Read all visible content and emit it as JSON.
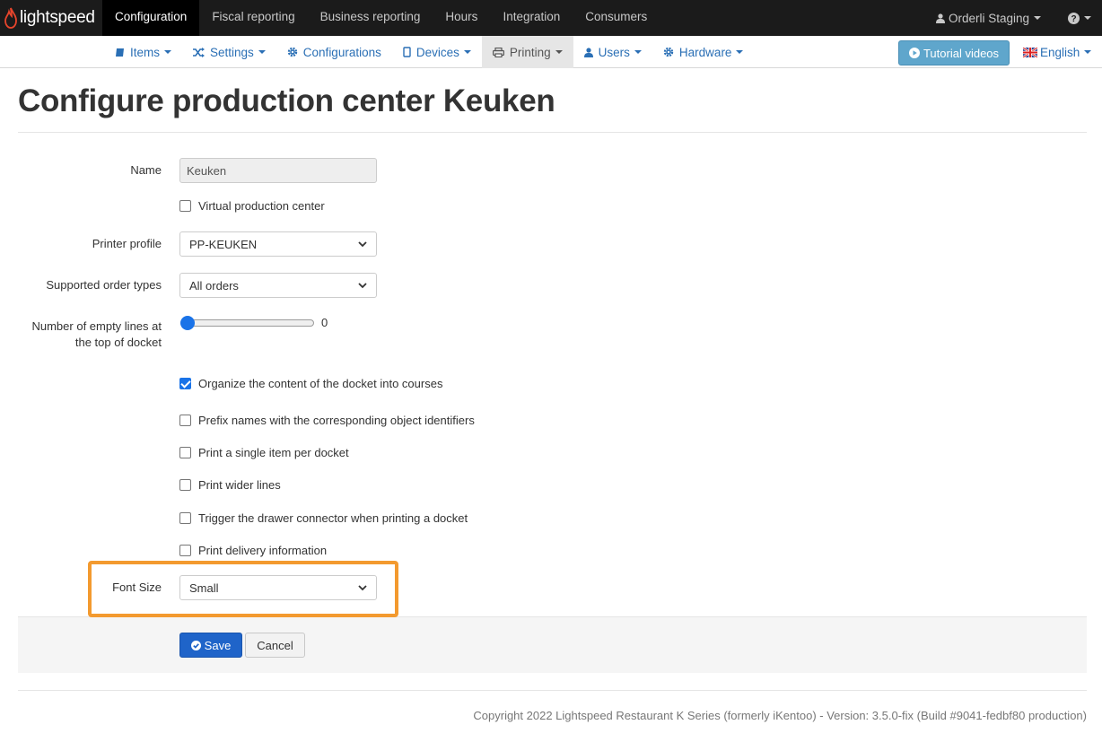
{
  "brand": {
    "name": "lightspeed"
  },
  "topnav": [
    {
      "label": "Configuration",
      "active": true
    },
    {
      "label": "Fiscal reporting"
    },
    {
      "label": "Business reporting"
    },
    {
      "label": "Hours"
    },
    {
      "label": "Integration"
    },
    {
      "label": "Consumers"
    }
  ],
  "account": {
    "label": "Orderli Staging"
  },
  "subnav": [
    {
      "label": "Items",
      "icon": "book-icon"
    },
    {
      "label": "Settings",
      "icon": "shuffle-icon"
    },
    {
      "label": "Configurations",
      "icon": "gear-icon"
    },
    {
      "label": "Devices",
      "icon": "tablet-icon"
    },
    {
      "label": "Printing",
      "icon": "printer-icon",
      "active": true
    },
    {
      "label": "Users",
      "icon": "user-icon"
    },
    {
      "label": "Hardware",
      "icon": "gear-icon"
    }
  ],
  "tutorial_button": "Tutorial videos",
  "language": "English",
  "page_title": "Configure production center Keuken",
  "form": {
    "name_label": "Name",
    "name_value": "Keuken",
    "virtual_label": "Virtual production center",
    "printer_profile_label": "Printer profile",
    "printer_profile_value": "PP-KEUKEN",
    "order_types_label": "Supported order types",
    "order_types_value": "All orders",
    "empty_lines_label_1": "Number of empty lines at",
    "empty_lines_label_2": "the top of docket",
    "empty_lines_value": "0",
    "empty_lines_level": 0,
    "options": [
      {
        "label": "Organize the content of the docket into courses",
        "checked": true
      },
      {
        "label": "Prefix names with the corresponding object identifiers",
        "checked": false
      },
      {
        "label": "Print a single item per docket",
        "checked": false
      },
      {
        "label": "Print wider lines",
        "checked": false
      },
      {
        "label": "Trigger the drawer connector when printing a docket",
        "checked": false
      },
      {
        "label": "Print delivery information",
        "checked": false
      }
    ],
    "font_size_label": "Font Size",
    "font_size_value": "Small"
  },
  "buttons": {
    "save": "Save",
    "cancel": "Cancel"
  },
  "footer": "Copyright 2022 Lightspeed Restaurant K Series (formerly iKentoo) - Version: 3.5.0-fix (Build #9041-fedbf80 production)",
  "colors": {
    "highlight": "#f39a2f",
    "primary": "#1f64c9",
    "link": "#2a6fb5"
  }
}
